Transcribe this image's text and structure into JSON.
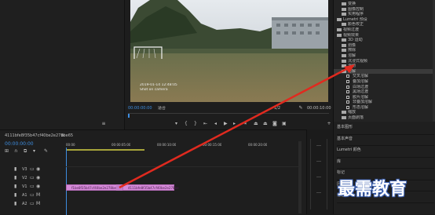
{
  "program": {
    "sequence_tab": "",
    "timecode_left": "00:00:00:00",
    "fit_label": "适合",
    "quality_label": "1/2",
    "timecode_right": "00:00:10:00",
    "video_overlay": {
      "line1": "2019-01-14 12:48:05",
      "line2": "Shot on camera"
    },
    "transport": [
      "marker-icon",
      "in-point-icon",
      "out-point-icon",
      "go-to-in-icon",
      "step-back-icon",
      "play-icon",
      "step-forward-icon",
      "go-to-out-icon",
      "lift-icon",
      "extract-icon",
      "export-frame-icon",
      "button-editor-icon"
    ]
  },
  "timeline": {
    "tab_name": "4111bfe8f35b47cf40be2e278be65",
    "timecode": "00:00:00:00",
    "ruler": [
      "00:00",
      "00:00:05:00",
      "00:00:10:00",
      "00:00:15:00",
      "00:00:20:00"
    ],
    "tracks": [
      {
        "label": "V3",
        "type": "video"
      },
      {
        "label": "V2",
        "type": "video"
      },
      {
        "label": "V1",
        "type": "video"
      },
      {
        "label": "A1",
        "type": "audio"
      },
      {
        "label": "A2",
        "type": "audio"
      }
    ],
    "clips": [
      {
        "name": "f1be8f35b47cf40be2e278be65.mp4",
        "color": "#d58ad8"
      },
      {
        "name": "4111bfe8f35b47cf40be2e278be",
        "color": "#d58ad8"
      }
    ]
  },
  "effects": {
    "items": [
      {
        "label": "变换",
        "kind": "folder",
        "indent": 2
      },
      {
        "label": "图像控制",
        "kind": "folder",
        "indent": 2
      },
      {
        "label": "实用程序",
        "kind": "folder",
        "indent": 2
      },
      {
        "label": "Lumetri 预设",
        "kind": "folder",
        "indent": 1
      },
      {
        "label": "颜色校正",
        "kind": "folder",
        "indent": 2
      },
      {
        "label": "视频过渡",
        "kind": "folder",
        "indent": 1
      },
      {
        "label": "视频效果",
        "kind": "folder",
        "indent": 1
      },
      {
        "label": "3D 运动",
        "kind": "folder",
        "indent": 2
      },
      {
        "label": "划像",
        "kind": "folder",
        "indent": 2
      },
      {
        "label": "擦除",
        "kind": "folder",
        "indent": 2
      },
      {
        "label": "溶解",
        "kind": "folder",
        "indent": 2
      },
      {
        "label": "沉浸式视频",
        "kind": "folder",
        "indent": 2
      },
      {
        "label": "滑动",
        "kind": "folder",
        "indent": 2
      },
      {
        "label": "溶解",
        "kind": "folder",
        "indent": 2,
        "selected": true
      },
      {
        "label": "交叉溶解",
        "kind": "effect",
        "indent": 3
      },
      {
        "label": "叠加溶解",
        "kind": "effect",
        "indent": 3
      },
      {
        "label": "白场过渡",
        "kind": "effect",
        "indent": 3
      },
      {
        "label": "黑场过渡",
        "kind": "effect",
        "indent": 3
      },
      {
        "label": "胶片溶解",
        "kind": "effect",
        "indent": 3
      },
      {
        "label": "非叠加溶解",
        "kind": "effect",
        "indent": 3
      },
      {
        "label": "形态溶解",
        "kind": "effect",
        "indent": 3
      },
      {
        "label": "缩放",
        "kind": "folder",
        "indent": 2
      },
      {
        "label": "页面剥落",
        "kind": "folder",
        "indent": 2
      }
    ]
  },
  "right_panels": [
    "基本图形",
    "基本声音",
    "Lumetri 颜色",
    "库",
    "标记",
    "历史记录",
    "信息"
  ],
  "watermark": "最需教育",
  "colors": {
    "accent": "#3d8de0",
    "arrow": "#e02a1f",
    "clip": "#d58ad8",
    "panel": "#232323"
  }
}
